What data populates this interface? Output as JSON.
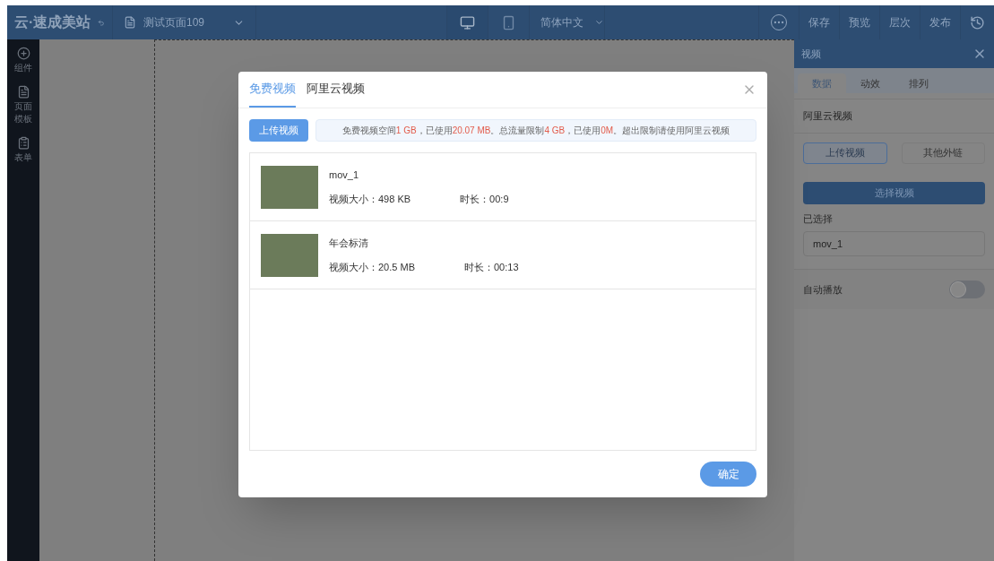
{
  "topbar": {
    "logo": "云·速成美站",
    "page_selector": "测试页面109",
    "devices": [
      {
        "kind": "desktop",
        "selected": true
      },
      {
        "kind": "mobile",
        "selected": false
      }
    ],
    "language": "简体中文",
    "actions": [
      "保存",
      "预览",
      "层次",
      "发布"
    ]
  },
  "sidebar": {
    "items": [
      {
        "kind": "add",
        "label": "组件"
      },
      {
        "kind": "page",
        "label": "页面模板"
      },
      {
        "kind": "form",
        "label": "表单"
      }
    ]
  },
  "modal": {
    "tabs": [
      {
        "label": "免费视频",
        "selected": true
      },
      {
        "label": "阿里云视频",
        "selected": false
      }
    ],
    "upload_button": "上传视频",
    "notice": [
      {
        "text": "免费视频空间",
        "highlight": false
      },
      {
        "text": "1 GB",
        "highlight": true
      },
      {
        "text": "，已使用",
        "highlight": false
      },
      {
        "text": "20.07 MB",
        "highlight": true
      },
      {
        "text": "。总流量限制",
        "highlight": false
      },
      {
        "text": "4 GB",
        "highlight": true
      },
      {
        "text": "，已使用",
        "highlight": false
      },
      {
        "text": "0M",
        "highlight": true
      },
      {
        "text": "。超出限制请使用阿里云视频",
        "highlight": false
      }
    ],
    "videos": [
      {
        "name": "mov_1",
        "size": "视频大小：498 KB",
        "duration": "时长：00:9"
      },
      {
        "name": "年会标清",
        "size": "视频大小：20.5 MB",
        "duration": "时长：00:13"
      }
    ],
    "confirm_button": "确定"
  },
  "panel": {
    "title": "视频",
    "tabs": [
      {
        "label": "数据",
        "selected": true
      },
      {
        "label": "动效",
        "selected": false
      },
      {
        "label": "排列",
        "selected": false
      }
    ],
    "section": "阿里云视频",
    "sources": [
      {
        "label": "上传视频",
        "selected": true
      },
      {
        "label": "其他外链",
        "selected": false
      }
    ],
    "select_button": "选择视频",
    "selected_label": "已选择",
    "selected_value": "mov_1",
    "autoplay": {
      "label": "自动播放",
      "on": false
    }
  }
}
